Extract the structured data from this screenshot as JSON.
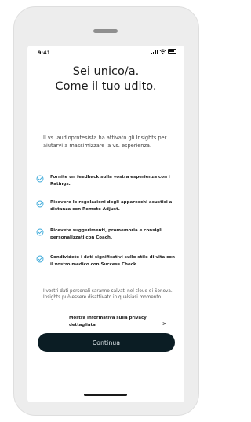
{
  "status_bar": {
    "time": "9:41",
    "icons": [
      "signal-icon",
      "wifi-icon",
      "battery-icon"
    ]
  },
  "screen": {
    "title_line1": "Sei unico/a.",
    "title_line2": "Come il tuo udito.",
    "intro": "Il vs. audioprotesista ha attivato gli Insights per aiutarvi a massimizzare la vs. esperienza.",
    "features": [
      {
        "icon": "check-circle-icon",
        "text": "Fornite un feedback sulla vostra esperienza con i Ratings."
      },
      {
        "icon": "check-circle-icon",
        "text": "Ricevere le regolazioni degli apparecchi acustici a distanza con Remote Adjust."
      },
      {
        "icon": "check-circle-icon",
        "text": "Ricevete suggerimenti, promemoria e consigli personalizzati con Coach."
      },
      {
        "icon": "check-circle-icon",
        "text": "Condividete i dati significativi sullo stile di vita con il vostro medico con Success Check."
      }
    ],
    "footnote": "I vostri dati personali saranno salvati nel cloud di Sonova. Insights può essere disattivato in qualsiasi momento.",
    "privacy_link": "Mostra Informativa sulla privacy dettagliata",
    "privacy_chevron": ">",
    "cta_label": "Continua"
  },
  "colors": {
    "accent": "#35a7d9",
    "button_bg": "#0b1d24",
    "frame": "#ededed"
  }
}
